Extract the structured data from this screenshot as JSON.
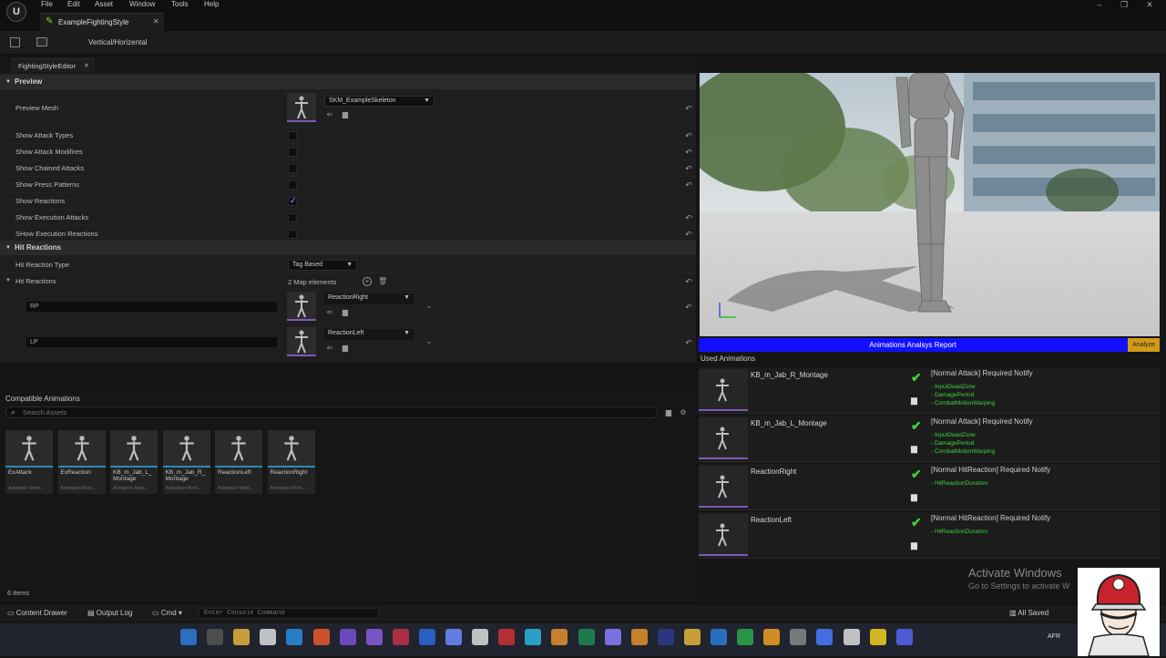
{
  "menubar": {
    "logo": "U",
    "items": [
      "File",
      "Edit",
      "Asset",
      "Window",
      "Tools",
      "Help"
    ]
  },
  "document_tab": {
    "label": "ExampleFightingStyle"
  },
  "toolbar": {
    "mode_label": "Vertical/Horizental"
  },
  "editor_tab": {
    "label": "FightingStyleEditor"
  },
  "details": {
    "preview_section": "Preview",
    "preview_mesh_label": "Preview Mesh",
    "preview_mesh_value": "SKM_ExampleSkeleton",
    "options": [
      {
        "label": "Show Attack Types",
        "checked": false
      },
      {
        "label": "Show Attack Modifires",
        "checked": false
      },
      {
        "label": "Show Chained Attacks",
        "checked": false
      },
      {
        "label": "Show Press Patterns",
        "checked": false
      },
      {
        "label": "Show Reactions",
        "checked": true
      },
      {
        "label": "Show Execution Attacks",
        "checked": false
      },
      {
        "label": "SHow Execution Reactions",
        "checked": false
      }
    ],
    "hit_section": "Hit Reactions",
    "hit_type_label": "Hit Reaction Type",
    "hit_type_value": "Tag Based",
    "hit_reactions_label": "Hit Reactions",
    "map_count": "2 Map elements",
    "entries": [
      {
        "key": "RP",
        "value": "ReactionRight"
      },
      {
        "key": "LP",
        "value": "ReactionLeft"
      }
    ]
  },
  "content": {
    "title": "Compatible Animations",
    "search_placeholder": "Search Assets",
    "items_count": "6 items",
    "assets": [
      {
        "name": "ExAttack",
        "type": "Animation Mont..."
      },
      {
        "name": "ExReaction",
        "type": "Animation Mont..."
      },
      {
        "name": "KB_m_Jab_L_ Montage",
        "type": "Animation Mont..."
      },
      {
        "name": "KB_m_Jab_R_ Montage",
        "type": "Animation Mont..."
      },
      {
        "name": "ReactionLeft",
        "type": "Animation Mont..."
      },
      {
        "name": "ReactionRight",
        "type": "Animation Mont..."
      }
    ]
  },
  "report": {
    "title": "Animations Analsys Report",
    "analyze_label": "Analyze",
    "used_label": "Used Animations",
    "rows": [
      {
        "name": "KB_m_Jab_R_Montage",
        "requirement": "[Normal Attack] Required Notify",
        "notifies": [
          "- InputDeadZone",
          "- DamagePeriod",
          "- CombatMotionWarping"
        ]
      },
      {
        "name": "KB_m_Jab_L_Montage",
        "requirement": "[Normal Attack] Required Notify",
        "notifies": [
          "- InputDeadZone",
          "- DamagePeriod",
          "- CombatMotionWarping"
        ]
      },
      {
        "name": "ReactionRight",
        "requirement": "[Normal HitReaction] Required Notify",
        "notifies": [
          "- HitReactionDuration"
        ]
      },
      {
        "name": "ReactionLeft",
        "requirement": "[Normal HitReaction] Required Notify",
        "notifies": [
          "- HitReactionDuration"
        ]
      }
    ]
  },
  "watermark": {
    "line1": "Activate Windows",
    "line2": "Go to Settings to activate W"
  },
  "statusbar": {
    "content_drawer": "Content Drawer",
    "output_log": "Output Log",
    "cmd": "Cmd",
    "console_placeholder": "Enter Console Command",
    "saved": "All Saved"
  },
  "taskbar": {
    "lang": "AFR"
  },
  "colors": {
    "accent_purple": "#7e5ab8",
    "check_green": "#3ed13e",
    "report_blue": "#1010ff",
    "analyze_gold": "#d39a18"
  }
}
